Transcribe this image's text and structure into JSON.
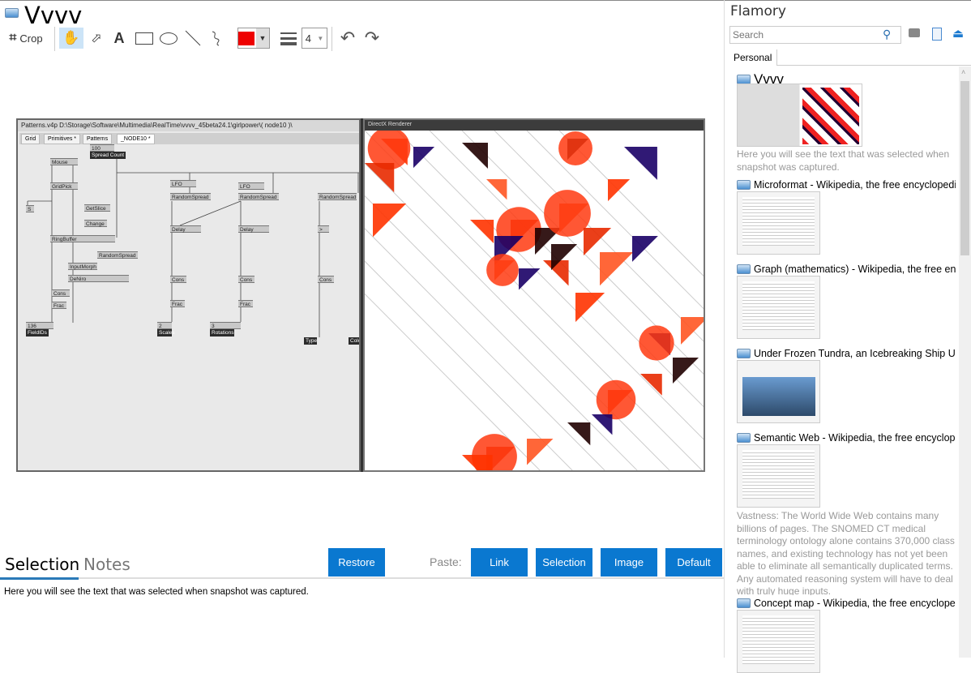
{
  "app": {
    "title": "Vvvv"
  },
  "toolbar": {
    "crop_label": "Crop",
    "stroke_width": "4",
    "color": "#ee0000"
  },
  "screenshot": {
    "editor_title": "Patterns.v4p    D:\\Storage\\Software\\Multimedia\\RealTime\\vvvv_45beta24.1\\girlpower\\( node10 )\\",
    "editor_tabs": [
      "Grid",
      "Primitives *",
      "Patterns",
      "_NODE10 *"
    ],
    "nodes": [
      "100",
      "Spread Count",
      "Mouse",
      "GridPick",
      "S",
      "GetSlice",
      "Change",
      "RingBuffer",
      "RandomSpread",
      "InputMorph",
      "DeNiro",
      "Cons",
      "Frac",
      "136",
      "FieldIDs",
      "LFO",
      "RandomSpread",
      "Delay",
      "Cons",
      "Frac",
      "2",
      "Scales",
      "LFO",
      "RandomSpread",
      "Delay",
      "Cons",
      "Frac",
      "3",
      "Rotations",
      "RandomSpread",
      ">",
      "Cons",
      "Type",
      "Colo"
    ],
    "renderer_title": "DirectX Renderer"
  },
  "bottom": {
    "tabs": [
      "Selection",
      "Notes"
    ],
    "restore": "Restore",
    "paste_label": "Paste:",
    "paste_buttons": [
      "Link",
      "Selection",
      "Image",
      "Default"
    ],
    "selection_text": "Here you will see the text that was selected when snapshot was captured."
  },
  "sidebar": {
    "title": "Flamory",
    "search_placeholder": "Search",
    "tab": "Personal",
    "items": [
      {
        "title": "Vvvv",
        "desc": "Here you will see the text that was selected when snapshot was captured."
      },
      {
        "title": "Microformat - Wikipedia, the free encyclopedia"
      },
      {
        "title": "Graph (mathematics) - Wikipedia, the free encyclopedia"
      },
      {
        "title": "Under Frozen Tundra, an Icebreaking Ship Uncovers"
      },
      {
        "title": "Semantic Web - Wikipedia, the free encyclopedia",
        "desc": "Vastness: The World Wide Web contains many billions of pages. The SNOMED CT medical terminology ontology alone contains 370,000 class names, and existing technology has not yet been able to eliminate all semantically duplicated terms. Any automated reasoning system will have to deal with truly huge inputs."
      },
      {
        "title": "Concept map - Wikipedia, the free encyclopedia"
      }
    ]
  }
}
